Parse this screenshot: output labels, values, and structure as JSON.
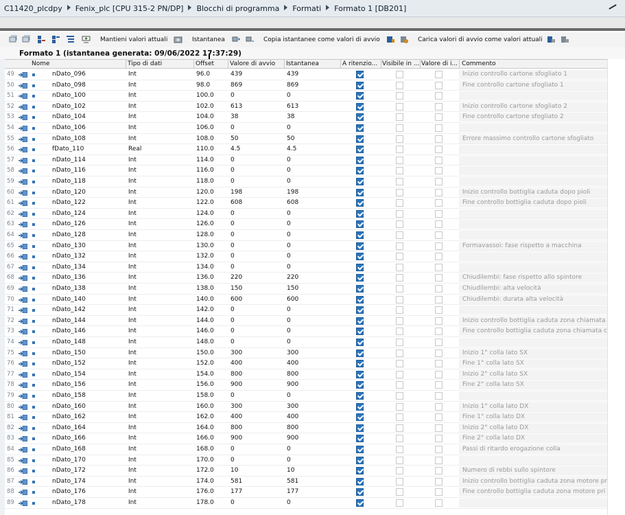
{
  "titlebar": {
    "crumbs": [
      "C11420_plcdpy",
      "Fenix_plc [CPU 315-2 PN/DP]",
      "Blocchi di programma",
      "Formati",
      "Formato 1 [DB201]"
    ]
  },
  "toolbar": {
    "keep_values_label": "Mantieni valori attuali",
    "snapshot_label": "Istantanea",
    "copy_snapshot_label": "Copia istantanee come valori di avvio",
    "load_start_values_label": "Carica valori di avvio come valori attuali"
  },
  "snapshot_title": "Formato 1 (istantanea generata: 09/06/2022 17:37:29)",
  "columns": [
    "Nome",
    "Tipo di dati",
    "Offset",
    "Valore di avvio",
    "Istantanea",
    "A ritenzio...",
    "Visibile in ...",
    "Valore di i...",
    "Commento"
  ],
  "rows": [
    {
      "n": "49",
      "name": "nDato_096",
      "type": "Int",
      "offset": "96.0",
      "start": "439",
      "snap": "439",
      "comment": "Inizio controllo cartone sfogliato 1"
    },
    {
      "n": "50",
      "name": "nDato_098",
      "type": "Int",
      "offset": "98.0",
      "start": "869",
      "snap": "869",
      "comment": "Fine controllo cartone sfogliato 1"
    },
    {
      "n": "51",
      "name": "nDato_100",
      "type": "Int",
      "offset": "100.0",
      "start": "0",
      "snap": "0",
      "comment": ""
    },
    {
      "n": "52",
      "name": "nDato_102",
      "type": "Int",
      "offset": "102.0",
      "start": "613",
      "snap": "613",
      "comment": "Inizio controllo cartone sfogliato 2"
    },
    {
      "n": "53",
      "name": "nDato_104",
      "type": "Int",
      "offset": "104.0",
      "start": "38",
      "snap": "38",
      "comment": "Fine controllo cartone sfogliato 2"
    },
    {
      "n": "54",
      "name": "nDato_106",
      "type": "Int",
      "offset": "106.0",
      "start": "0",
      "snap": "0",
      "comment": ""
    },
    {
      "n": "55",
      "name": "nDato_108",
      "type": "Int",
      "offset": "108.0",
      "start": "50",
      "snap": "50",
      "comment": "Errore massimo controllo cartone sfogliato"
    },
    {
      "n": "56",
      "name": "fDato_110",
      "type": "Real",
      "offset": "110.0",
      "start": "4.5",
      "snap": "4.5",
      "comment": ""
    },
    {
      "n": "57",
      "name": "nDato_114",
      "type": "Int",
      "offset": "114.0",
      "start": "0",
      "snap": "0",
      "comment": ""
    },
    {
      "n": "58",
      "name": "nDato_116",
      "type": "Int",
      "offset": "116.0",
      "start": "0",
      "snap": "0",
      "comment": ""
    },
    {
      "n": "59",
      "name": "nDato_118",
      "type": "Int",
      "offset": "118.0",
      "start": "0",
      "snap": "0",
      "comment": ""
    },
    {
      "n": "60",
      "name": "nDato_120",
      "type": "Int",
      "offset": "120.0",
      "start": "198",
      "snap": "198",
      "comment": "Inizio controllo bottiglia caduta dopo pioli"
    },
    {
      "n": "61",
      "name": "nDato_122",
      "type": "Int",
      "offset": "122.0",
      "start": "608",
      "snap": "608",
      "comment": "Fine controllo bottiglia caduta dopo pioli"
    },
    {
      "n": "62",
      "name": "nDato_124",
      "type": "Int",
      "offset": "124.0",
      "start": "0",
      "snap": "0",
      "comment": ""
    },
    {
      "n": "63",
      "name": "nDato_126",
      "type": "Int",
      "offset": "126.0",
      "start": "0",
      "snap": "0",
      "comment": ""
    },
    {
      "n": "64",
      "name": "nDato_128",
      "type": "Int",
      "offset": "128.0",
      "start": "0",
      "snap": "0",
      "comment": ""
    },
    {
      "n": "65",
      "name": "nDato_130",
      "type": "Int",
      "offset": "130.0",
      "start": "0",
      "snap": "0",
      "comment": "Formavassoi: fase rispetto a macchina"
    },
    {
      "n": "66",
      "name": "nDato_132",
      "type": "Int",
      "offset": "132.0",
      "start": "0",
      "snap": "0",
      "comment": ""
    },
    {
      "n": "67",
      "name": "nDato_134",
      "type": "Int",
      "offset": "134.0",
      "start": "0",
      "snap": "0",
      "comment": ""
    },
    {
      "n": "68",
      "name": "nDato_136",
      "type": "Int",
      "offset": "136.0",
      "start": "220",
      "snap": "220",
      "comment": "Chiudilembi: fase rispetto allo spintore"
    },
    {
      "n": "69",
      "name": "nDato_138",
      "type": "Int",
      "offset": "138.0",
      "start": "150",
      "snap": "150",
      "comment": "Chiudilembi: alta velocità"
    },
    {
      "n": "70",
      "name": "nDato_140",
      "type": "Int",
      "offset": "140.0",
      "start": "600",
      "snap": "600",
      "comment": "Chiudilembi: durata alta velocità"
    },
    {
      "n": "71",
      "name": "nDato_142",
      "type": "Int",
      "offset": "142.0",
      "start": "0",
      "snap": "0",
      "comment": ""
    },
    {
      "n": "72",
      "name": "nDato_144",
      "type": "Int",
      "offset": "144.0",
      "start": "0",
      "snap": "0",
      "comment": "Inizio controllo bottiglia caduta zona chiamata"
    },
    {
      "n": "73",
      "name": "nDato_146",
      "type": "Int",
      "offset": "146.0",
      "start": "0",
      "snap": "0",
      "comment": "Fine controllo bottiglia caduta zona chiamata c"
    },
    {
      "n": "74",
      "name": "nDato_148",
      "type": "Int",
      "offset": "148.0",
      "start": "0",
      "snap": "0",
      "comment": ""
    },
    {
      "n": "75",
      "name": "nDato_150",
      "type": "Int",
      "offset": "150.0",
      "start": "300",
      "snap": "300",
      "comment": "Inizio 1° colla lato SX"
    },
    {
      "n": "76",
      "name": "nDato_152",
      "type": "Int",
      "offset": "152.0",
      "start": "400",
      "snap": "400",
      "comment": "Fine 1° colla lato SX"
    },
    {
      "n": "77",
      "name": "nDato_154",
      "type": "Int",
      "offset": "154.0",
      "start": "800",
      "snap": "800",
      "comment": "Inizio 2° colla lato SX"
    },
    {
      "n": "78",
      "name": "nDato_156",
      "type": "Int",
      "offset": "156.0",
      "start": "900",
      "snap": "900",
      "comment": "Fine 2° colla lato SX"
    },
    {
      "n": "79",
      "name": "nDato_158",
      "type": "Int",
      "offset": "158.0",
      "start": "0",
      "snap": "0",
      "comment": ""
    },
    {
      "n": "80",
      "name": "nDato_160",
      "type": "Int",
      "offset": "160.0",
      "start": "300",
      "snap": "300",
      "comment": "Inizio 1° colla lato DX"
    },
    {
      "n": "81",
      "name": "nDato_162",
      "type": "Int",
      "offset": "162.0",
      "start": "400",
      "snap": "400",
      "comment": "Fine 1° colla lato DX"
    },
    {
      "n": "82",
      "name": "nDato_164",
      "type": "Int",
      "offset": "164.0",
      "start": "800",
      "snap": "800",
      "comment": "Inizio 2° colla lato DX"
    },
    {
      "n": "83",
      "name": "nDato_166",
      "type": "Int",
      "offset": "166.0",
      "start": "900",
      "snap": "900",
      "comment": "Fine 2° colla lato DX"
    },
    {
      "n": "84",
      "name": "nDato_168",
      "type": "Int",
      "offset": "168.0",
      "start": "0",
      "snap": "0",
      "comment": "Passi di ritardo erogazione colla"
    },
    {
      "n": "85",
      "name": "nDato_170",
      "type": "Int",
      "offset": "170.0",
      "start": "0",
      "snap": "0",
      "comment": ""
    },
    {
      "n": "86",
      "name": "nDato_172",
      "type": "Int",
      "offset": "172.0",
      "start": "10",
      "snap": "10",
      "comment": "Numero di rebbi sullo spintore"
    },
    {
      "n": "87",
      "name": "nDato_174",
      "type": "Int",
      "offset": "174.0",
      "start": "581",
      "snap": "581",
      "comment": "Inizio controllo bottiglia caduta zona motore pr"
    },
    {
      "n": "88",
      "name": "nDato_176",
      "type": "Int",
      "offset": "176.0",
      "start": "177",
      "snap": "177",
      "comment": "Fine controllo bottiglia caduta zona motore pri"
    },
    {
      "n": "89",
      "name": "nDato_178",
      "type": "Int",
      "offset": "178.0",
      "start": "0",
      "snap": "0",
      "comment": ""
    }
  ]
}
